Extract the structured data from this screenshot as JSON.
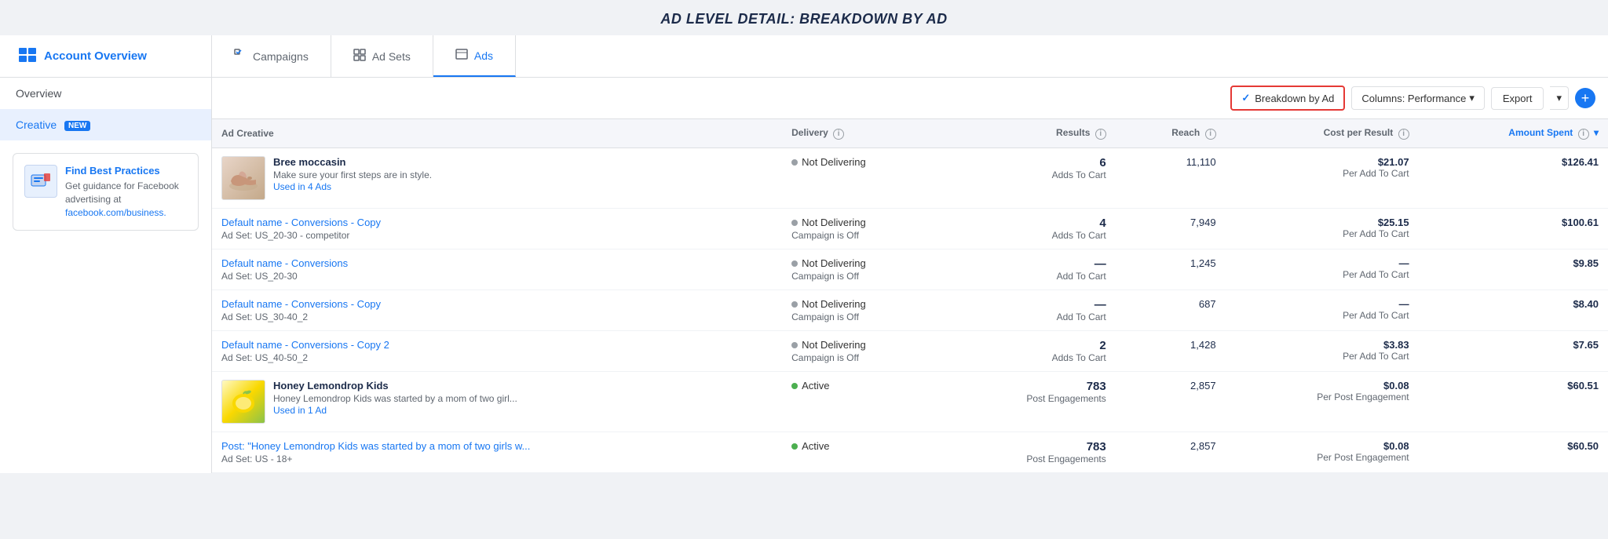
{
  "page": {
    "title": "AD LEVEL DETAIL: BREAKDOWN BY AD"
  },
  "top_nav": {
    "account_label": "Account Overview",
    "tabs": [
      {
        "id": "campaigns",
        "label": "Campaigns",
        "active": false
      },
      {
        "id": "ad_sets",
        "label": "Ad Sets",
        "active": false
      },
      {
        "id": "ads",
        "label": "Ads",
        "active": true
      }
    ]
  },
  "sidebar": {
    "overview_label": "Overview",
    "creative_label": "Creative",
    "creative_badge": "NEW",
    "card": {
      "title": "Find Best Practices",
      "text": "Get guidance for Facebook advertising at ",
      "link_text": "facebook.com/business.",
      "link_url": "#"
    }
  },
  "toolbar": {
    "breakdown_label": "Breakdown by Ad",
    "columns_label": "Columns: Performance",
    "export_label": "Export"
  },
  "table": {
    "headers": [
      {
        "id": "ad_creative",
        "label": "Ad Creative"
      },
      {
        "id": "delivery",
        "label": "Delivery"
      },
      {
        "id": "results",
        "label": "Results"
      },
      {
        "id": "reach",
        "label": "Reach"
      },
      {
        "id": "cost_per_result",
        "label": "Cost per Result"
      },
      {
        "id": "amount_spent",
        "label": "Amount Spent"
      }
    ],
    "rows": [
      {
        "id": "row1",
        "thumb_type": "shoe",
        "thumb_emoji": "👟",
        "ad_name": "Bree moccasin",
        "ad_desc": "Make sure your first steps are in style.",
        "ad_link": "Used in 4 Ads",
        "ad_set": "",
        "delivery": "Not Delivering",
        "delivery_dot": "grey",
        "delivery_sub": "",
        "results_num": "6",
        "results_type": "Adds To Cart",
        "reach": "11,110",
        "cost_num": "$21.07",
        "cost_sub": "Per Add To Cart",
        "amount": "$126.41"
      },
      {
        "id": "row2",
        "thumb_type": "none",
        "ad_name": "Default name - Conversions - Copy",
        "ad_desc": "",
        "ad_link": "",
        "ad_set": "Ad Set: US_20-30 - competitor",
        "delivery": "Not Delivering",
        "delivery_dot": "grey",
        "delivery_sub": "Campaign is Off",
        "results_num": "4",
        "results_type": "Adds To Cart",
        "reach": "7,949",
        "cost_num": "$25.15",
        "cost_sub": "Per Add To Cart",
        "amount": "$100.61"
      },
      {
        "id": "row3",
        "thumb_type": "none",
        "ad_name": "Default name - Conversions",
        "ad_desc": "",
        "ad_link": "",
        "ad_set": "Ad Set: US_20-30",
        "delivery": "Not Delivering",
        "delivery_dot": "grey",
        "delivery_sub": "Campaign is Off",
        "results_num": "—",
        "results_type": "Add To Cart",
        "reach": "1,245",
        "cost_num": "—",
        "cost_sub": "Per Add To Cart",
        "amount": "$9.85"
      },
      {
        "id": "row4",
        "thumb_type": "none",
        "ad_name": "Default name - Conversions - Copy",
        "ad_desc": "",
        "ad_link": "",
        "ad_set": "Ad Set: US_30-40_2",
        "delivery": "Not Delivering",
        "delivery_dot": "grey",
        "delivery_sub": "Campaign is Off",
        "results_num": "—",
        "results_type": "Add To Cart",
        "reach": "687",
        "cost_num": "—",
        "cost_sub": "Per Add To Cart",
        "amount": "$8.40"
      },
      {
        "id": "row5",
        "thumb_type": "none",
        "ad_name": "Default name - Conversions - Copy 2",
        "ad_desc": "",
        "ad_link": "",
        "ad_set": "Ad Set: US_40-50_2",
        "delivery": "Not Delivering",
        "delivery_dot": "grey",
        "delivery_sub": "Campaign is Off",
        "results_num": "2",
        "results_type": "Adds To Cart",
        "reach": "1,428",
        "cost_num": "$3.83",
        "cost_sub": "Per Add To Cart",
        "amount": "$7.65"
      },
      {
        "id": "row6",
        "thumb_type": "lemon",
        "thumb_emoji": "🍋",
        "ad_name": "Honey Lemondrop Kids",
        "ad_desc": "Honey Lemondrop Kids was started by a mom of two girl...",
        "ad_link": "Used in 1 Ad",
        "ad_set": "",
        "delivery": "Active",
        "delivery_dot": "green",
        "delivery_sub": "",
        "results_num": "783",
        "results_type": "Post Engagements",
        "reach": "2,857",
        "cost_num": "$0.08",
        "cost_sub": "Per Post Engagement",
        "amount": "$60.51"
      },
      {
        "id": "row7",
        "thumb_type": "none",
        "ad_name": "Post: \"Honey Lemondrop Kids was started by a mom of two girls w...",
        "ad_desc": "",
        "ad_link": "",
        "ad_set": "Ad Set: US - 18+",
        "delivery": "Active",
        "delivery_dot": "green",
        "delivery_sub": "",
        "results_num": "783",
        "results_type": "Post Engagements",
        "reach": "2,857",
        "cost_num": "$0.08",
        "cost_sub": "Per Post Engagement",
        "amount": "$60.50"
      }
    ]
  }
}
